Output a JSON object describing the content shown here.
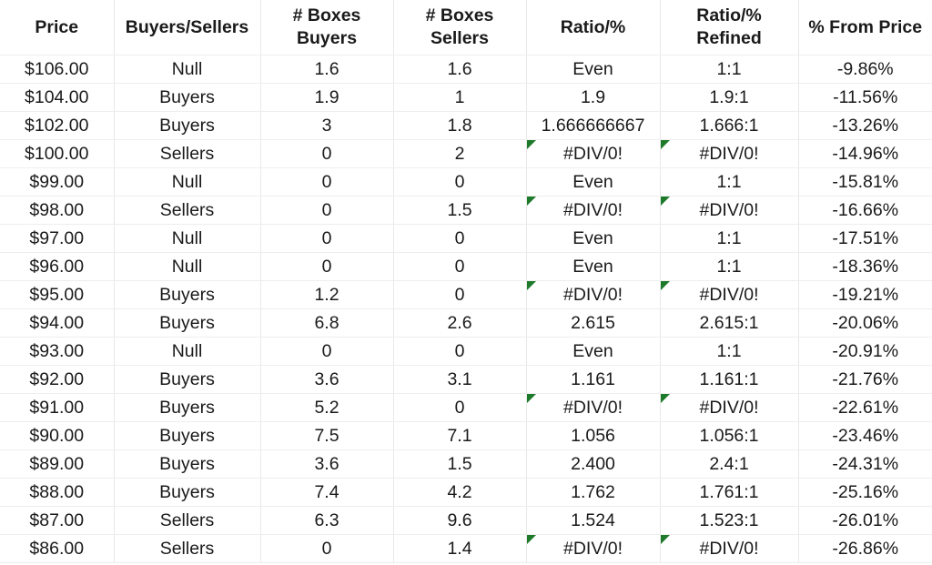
{
  "sheet": {
    "colors": {
      "header_bg": "#fbc794",
      "header_text": "#3b3b72",
      "buyers_bg": "#bfe8cb",
      "buyers_text": "#1f7a2e",
      "sellers_bg": "#fcc4cc",
      "sellers_text": "#b4122b",
      "null_bg": "#fbe495",
      "null_text": "#9c6b13",
      "error_marker": "#1e7a2b",
      "cell_text": "#1a1a1a",
      "gridline": "#e8e8e8"
    },
    "columns": [
      {
        "key": "price",
        "label": "Price",
        "label_line2": ""
      },
      {
        "key": "signal",
        "label": "Buyers/Sellers",
        "label_line2": ""
      },
      {
        "key": "boxes_buyers",
        "label": "# Boxes",
        "label_line2": "Buyers"
      },
      {
        "key": "boxes_sellers",
        "label": "# Boxes",
        "label_line2": "Sellers"
      },
      {
        "key": "ratio",
        "label": "Ratio/%",
        "label_line2": ""
      },
      {
        "key": "ratio_refined",
        "label": "Ratio/%",
        "label_line2": "Refined"
      },
      {
        "key": "pct_from_price",
        "label": "% From Price",
        "label_line2": ""
      }
    ],
    "rows": [
      {
        "price": "$106.00",
        "signal": "Null",
        "boxes_buyers": "1.6",
        "boxes_sellers": "1.6",
        "ratio": "Even",
        "ratio_error": false,
        "ratio_refined": "1:1",
        "refined_error": false,
        "pct_from_price": "-9.86%"
      },
      {
        "price": "$104.00",
        "signal": "Buyers",
        "boxes_buyers": "1.9",
        "boxes_sellers": "1",
        "ratio": "1.9",
        "ratio_error": false,
        "ratio_refined": "1.9:1",
        "refined_error": false,
        "pct_from_price": "-11.56%"
      },
      {
        "price": "$102.00",
        "signal": "Buyers",
        "boxes_buyers": "3",
        "boxes_sellers": "1.8",
        "ratio": "1.666666667",
        "ratio_error": false,
        "ratio_refined": "1.666:1",
        "refined_error": false,
        "pct_from_price": "-13.26%"
      },
      {
        "price": "$100.00",
        "signal": "Sellers",
        "boxes_buyers": "0",
        "boxes_sellers": "2",
        "ratio": "#DIV/0!",
        "ratio_error": true,
        "ratio_refined": "#DIV/0!",
        "refined_error": true,
        "pct_from_price": "-14.96%"
      },
      {
        "price": "$99.00",
        "signal": "Null",
        "boxes_buyers": "0",
        "boxes_sellers": "0",
        "ratio": "Even",
        "ratio_error": false,
        "ratio_refined": "1:1",
        "refined_error": false,
        "pct_from_price": "-15.81%"
      },
      {
        "price": "$98.00",
        "signal": "Sellers",
        "boxes_buyers": "0",
        "boxes_sellers": "1.5",
        "ratio": "#DIV/0!",
        "ratio_error": true,
        "ratio_refined": "#DIV/0!",
        "refined_error": true,
        "pct_from_price": "-16.66%"
      },
      {
        "price": "$97.00",
        "signal": "Null",
        "boxes_buyers": "0",
        "boxes_sellers": "0",
        "ratio": "Even",
        "ratio_error": false,
        "ratio_refined": "1:1",
        "refined_error": false,
        "pct_from_price": "-17.51%"
      },
      {
        "price": "$96.00",
        "signal": "Null",
        "boxes_buyers": "0",
        "boxes_sellers": "0",
        "ratio": "Even",
        "ratio_error": false,
        "ratio_refined": "1:1",
        "refined_error": false,
        "pct_from_price": "-18.36%"
      },
      {
        "price": "$95.00",
        "signal": "Buyers",
        "boxes_buyers": "1.2",
        "boxes_sellers": "0",
        "ratio": "#DIV/0!",
        "ratio_error": true,
        "ratio_refined": "#DIV/0!",
        "refined_error": true,
        "pct_from_price": "-19.21%"
      },
      {
        "price": "$94.00",
        "signal": "Buyers",
        "boxes_buyers": "6.8",
        "boxes_sellers": "2.6",
        "ratio": "2.615",
        "ratio_error": false,
        "ratio_refined": "2.615:1",
        "refined_error": false,
        "pct_from_price": "-20.06%"
      },
      {
        "price": "$93.00",
        "signal": "Null",
        "boxes_buyers": "0",
        "boxes_sellers": "0",
        "ratio": "Even",
        "ratio_error": false,
        "ratio_refined": "1:1",
        "refined_error": false,
        "pct_from_price": "-20.91%"
      },
      {
        "price": "$92.00",
        "signal": "Buyers",
        "boxes_buyers": "3.6",
        "boxes_sellers": "3.1",
        "ratio": "1.161",
        "ratio_error": false,
        "ratio_refined": "1.161:1",
        "refined_error": false,
        "pct_from_price": "-21.76%"
      },
      {
        "price": "$91.00",
        "signal": "Buyers",
        "boxes_buyers": "5.2",
        "boxes_sellers": "0",
        "ratio": "#DIV/0!",
        "ratio_error": true,
        "ratio_refined": "#DIV/0!",
        "refined_error": true,
        "pct_from_price": "-22.61%"
      },
      {
        "price": "$90.00",
        "signal": "Buyers",
        "boxes_buyers": "7.5",
        "boxes_sellers": "7.1",
        "ratio": "1.056",
        "ratio_error": false,
        "ratio_refined": "1.056:1",
        "refined_error": false,
        "pct_from_price": "-23.46%"
      },
      {
        "price": "$89.00",
        "signal": "Buyers",
        "boxes_buyers": "3.6",
        "boxes_sellers": "1.5",
        "ratio": "2.400",
        "ratio_error": false,
        "ratio_refined": "2.4:1",
        "refined_error": false,
        "pct_from_price": "-24.31%"
      },
      {
        "price": "$88.00",
        "signal": "Buyers",
        "boxes_buyers": "7.4",
        "boxes_sellers": "4.2",
        "ratio": "1.762",
        "ratio_error": false,
        "ratio_refined": "1.761:1",
        "refined_error": false,
        "pct_from_price": "-25.16%"
      },
      {
        "price": "$87.00",
        "signal": "Sellers",
        "boxes_buyers": "6.3",
        "boxes_sellers": "9.6",
        "ratio": "1.524",
        "ratio_error": false,
        "ratio_refined": "1.523:1",
        "refined_error": false,
        "pct_from_price": "-26.01%"
      },
      {
        "price": "$86.00",
        "signal": "Sellers",
        "boxes_buyers": "0",
        "boxes_sellers": "1.4",
        "ratio": "#DIV/0!",
        "ratio_error": true,
        "ratio_refined": "#DIV/0!",
        "refined_error": true,
        "pct_from_price": "-26.86%"
      }
    ]
  }
}
